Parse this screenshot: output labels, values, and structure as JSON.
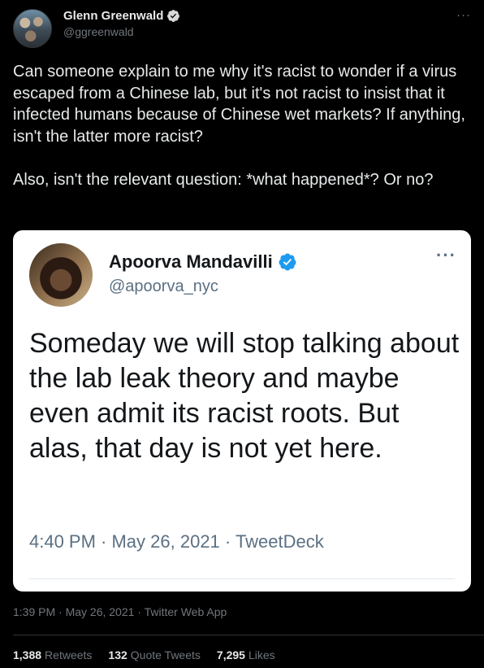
{
  "tweet": {
    "author": {
      "name": "Glenn Greenwald",
      "handle": "@ggreenwald",
      "verified": true
    },
    "text": "Can someone explain to me why it's racist to wonder if a virus escaped from a Chinese lab, but it's not racist to insist that it infected humans because of Chinese wet markets? If anything, isn't the latter more racist?\n\nAlso, isn't the relevant question: *what happened*? Or no?",
    "meta": "1:39 PM · May 26, 2021 · Twitter Web App",
    "more_icon": "more-horizontal-icon"
  },
  "quoted_screenshot": {
    "author": {
      "name": "Apoorva Mandavilli",
      "handle": "@apoorva_nyc",
      "verified": true
    },
    "text": "Someday we will stop talking about the lab leak theory and maybe even admit its racist roots. But alas, that day is not yet here.",
    "meta": "4:40 PM · May 26, 2021 · TweetDeck"
  },
  "stats": [
    {
      "count": "1,388",
      "label": "Retweets"
    },
    {
      "count": "132",
      "label": "Quote Tweets"
    },
    {
      "count": "7,295",
      "label": "Likes"
    }
  ],
  "colors": {
    "verified": "#1d9bf0",
    "background": "#000000",
    "muted": "#71767b"
  }
}
